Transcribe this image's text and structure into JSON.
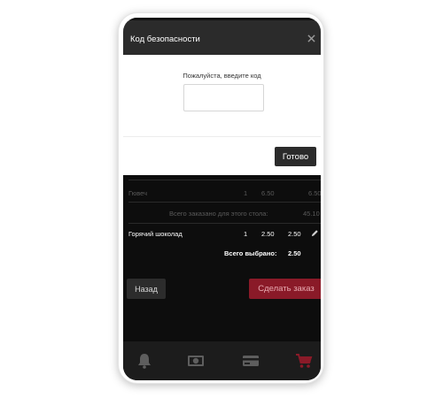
{
  "modal": {
    "title": "Код безопасности",
    "prompt": "Пожалуйста, введите код",
    "code_value": "",
    "done_label": "Готово"
  },
  "order": {
    "rows": [
      {
        "name": "Гювеч",
        "qty": "1",
        "price": "6.50",
        "total": "6.50"
      }
    ],
    "table_total_label": "Всего заказано для этого стола:",
    "table_total_value": "45.10",
    "selected_rows": [
      {
        "name": "Горячий шоколад",
        "qty": "1",
        "price": "2.50",
        "total": "2.50"
      }
    ],
    "selected_total_label": "Всего выбрано:",
    "selected_total_value": "2.50"
  },
  "actions": {
    "back_label": "Назад",
    "place_order_label": "Сделать заказ"
  },
  "tabs": [
    {
      "icon": "bell-icon"
    },
    {
      "icon": "cash-icon"
    },
    {
      "icon": "credit-card-icon"
    },
    {
      "icon": "cart-icon"
    }
  ],
  "colors": {
    "accent": "#8a1a28",
    "header": "#2b2b2b",
    "active_tab": "#8a1a28"
  }
}
